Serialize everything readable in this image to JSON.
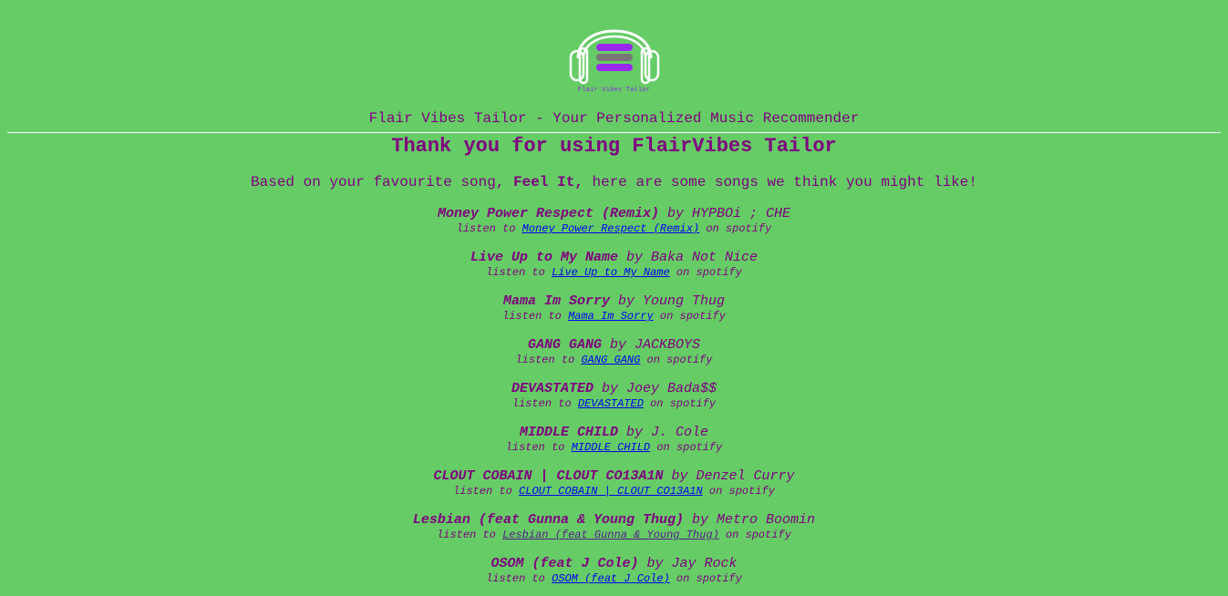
{
  "logo": {
    "caption": "Flair Vibes Tailor",
    "colors": {
      "outline": "#ffffff",
      "purple": "#9a29f0",
      "gray": "#777777"
    }
  },
  "tagline": "Flair Vibes Tailor - Your Personalized Music Recommender",
  "heading": "Thank you for using FlairVibes Tailor",
  "intro": {
    "prefix": "Based on your favourite song,",
    "song": "Feel It,",
    "suffix": "here are some songs we think you might like!"
  },
  "labels": {
    "by": "by",
    "listen_to": "listen to",
    "on_spotify": "on spotify"
  },
  "songs": [
    {
      "title": "Money Power Respect (Remix)",
      "artist": "HYPBOi ; CHE"
    },
    {
      "title": "Live Up to My Name",
      "artist": "Baka Not Nice"
    },
    {
      "title": "Mama Im Sorry",
      "artist": "Young Thug"
    },
    {
      "title": "GANG GANG",
      "artist": "JACKBOYS"
    },
    {
      "title": "DEVASTATED",
      "artist": "Joey Bada$$"
    },
    {
      "title": "MIDDLE CHILD",
      "artist": "J. Cole"
    },
    {
      "title": "CLOUT COBAIN | CLOUT CO13A1N",
      "artist": "Denzel Curry"
    },
    {
      "title": "Lesbian (feat Gunna & Young Thug)",
      "artist": "Metro Boomin",
      "visited": true
    },
    {
      "title": "OSOM (feat J Cole)",
      "artist": "Jay Rock"
    }
  ],
  "colors": {
    "background": "#66cc66",
    "text": "#800080",
    "link": "#0000ee",
    "visited_link": "#551a8b",
    "divider": "#ffffff"
  }
}
